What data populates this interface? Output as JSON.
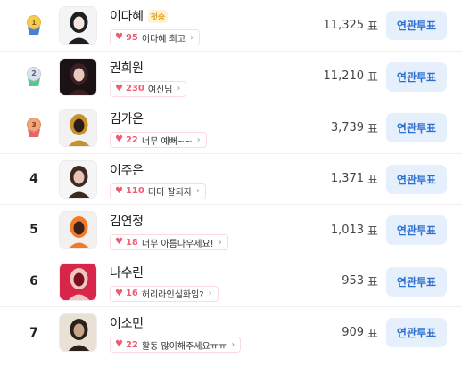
{
  "rows": [
    {
      "rank": "1",
      "medal": "gold",
      "name": "이다혜",
      "badge": "첫승",
      "hearts": "95",
      "message": "이다혜 최고",
      "votes": "11,325",
      "unit": "표",
      "button": "연관투표",
      "avatar_colors": [
        "#f4f4f6",
        "#1f1f22",
        "#f6e6e0"
      ]
    },
    {
      "rank": "2",
      "medal": "silver",
      "name": "권희원",
      "badge": "",
      "hearts": "230",
      "message": "여신님",
      "votes": "11,210",
      "unit": "표",
      "button": "연관투표",
      "avatar_colors": [
        "#1a1214",
        "#3a2024",
        "#e9c9bd"
      ]
    },
    {
      "rank": "3",
      "medal": "bronze",
      "name": "김가은",
      "badge": "",
      "hearts": "22",
      "message": "너무 예뻐~~",
      "votes": "3,739",
      "unit": "표",
      "button": "연관투표",
      "avatar_colors": [
        "#f2f2f3",
        "#c9912a",
        "#2a1d17"
      ]
    },
    {
      "rank": "4",
      "medal": "",
      "name": "이주은",
      "badge": "",
      "hearts": "110",
      "message": "더더 잘되자",
      "votes": "1,371",
      "unit": "표",
      "button": "연관투표",
      "avatar_colors": [
        "#f5f5f5",
        "#3b2a24",
        "#e9c4b5"
      ]
    },
    {
      "rank": "5",
      "medal": "",
      "name": "김연정",
      "badge": "",
      "hearts": "18",
      "message": "너무 아름다우세요!",
      "votes": "1,013",
      "unit": "표",
      "button": "연관투표",
      "avatar_colors": [
        "#f3f1ef",
        "#f07a2a",
        "#3a221a"
      ]
    },
    {
      "rank": "6",
      "medal": "",
      "name": "나수린",
      "badge": "",
      "hearts": "16",
      "message": "허리라인실화임?",
      "votes": "953",
      "unit": "표",
      "button": "연관투표",
      "avatar_colors": [
        "#d8264a",
        "#f0c8c0",
        "#7a1020"
      ]
    },
    {
      "rank": "7",
      "medal": "",
      "name": "이소민",
      "badge": "",
      "hearts": "22",
      "message": "활동 많이해주세요ㅠㅠ",
      "votes": "909",
      "unit": "표",
      "button": "연관투표",
      "avatar_colors": [
        "#e9e1d6",
        "#2a211c",
        "#c7a68a"
      ]
    }
  ]
}
